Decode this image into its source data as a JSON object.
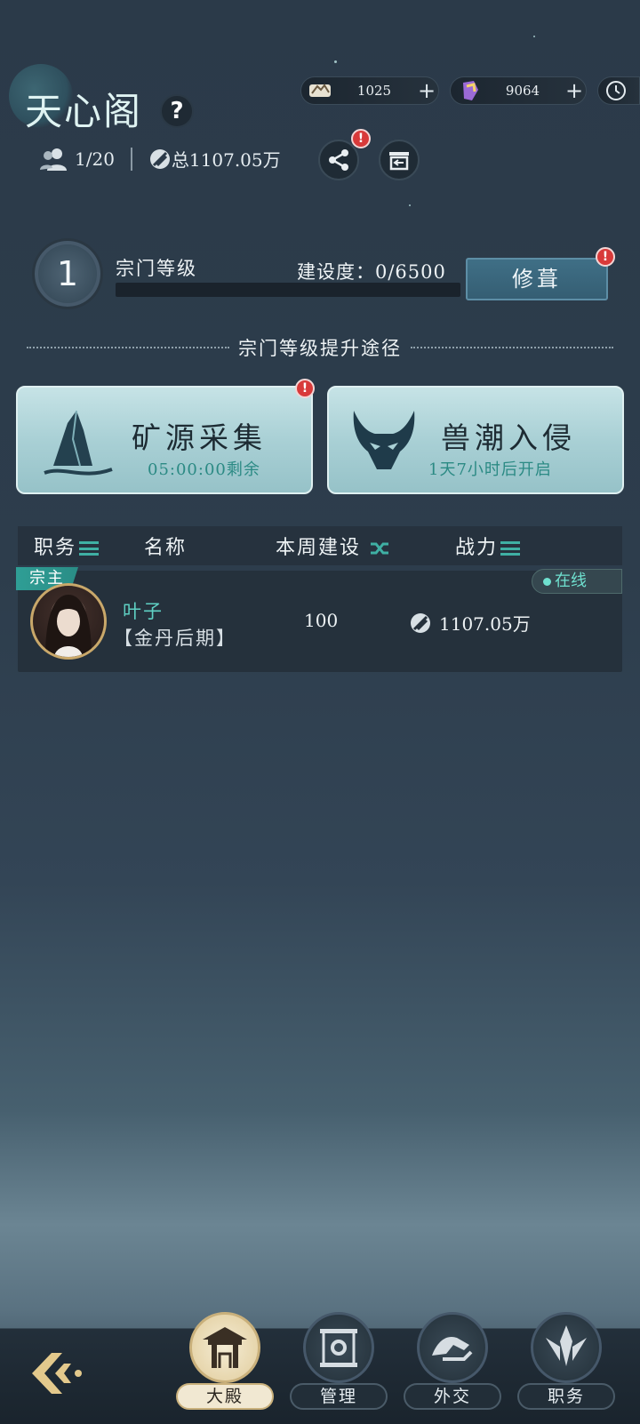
{
  "header": {
    "sect_name": "天心阁",
    "help_icon": "question-icon",
    "currencies": [
      {
        "icon": "silver-coin-icon",
        "value": "1025"
      },
      {
        "icon": "spirit-stone-icon",
        "value": "9064"
      }
    ],
    "members_count": "1/20",
    "total_power": "总1107.05万",
    "share_badge": "!"
  },
  "level": {
    "value": "1",
    "label": "宗门等级",
    "construction": "建设度：0/6500",
    "progress": 0,
    "repair_label": "修葺",
    "repair_badge": "!"
  },
  "routes": {
    "title": "宗门等级提升途径",
    "cards": [
      {
        "name": "矿源采集",
        "sub": "05:00:00剩余",
        "icon": "mountain-icon",
        "badge": "!"
      },
      {
        "name": "兽潮入侵",
        "sub": "1天7小时后开启",
        "icon": "demon-mask-icon"
      }
    ]
  },
  "table": {
    "headers": [
      "职务",
      "名称",
      "本周建设",
      "战力"
    ],
    "rows": [
      {
        "role": "宗主",
        "status": "在线",
        "name": "叶子",
        "realm": "【金丹后期】",
        "week_build": "100",
        "power": "1107.05万"
      }
    ]
  },
  "nav": {
    "tabs": [
      {
        "label": "大殿",
        "active": true
      },
      {
        "label": "管理",
        "active": false
      },
      {
        "label": "外交",
        "active": false
      },
      {
        "label": "职务",
        "active": false
      }
    ]
  },
  "colors": {
    "accent": "#3fb0a4",
    "alert": "#d83a3a",
    "background": "#2b3a49"
  }
}
